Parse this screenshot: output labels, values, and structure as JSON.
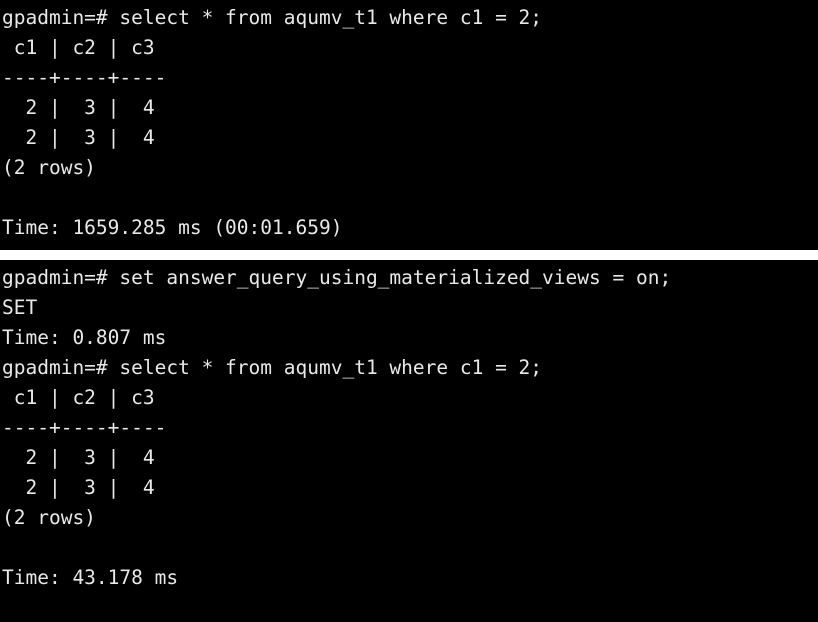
{
  "terminals": [
    {
      "name": "top-terminal",
      "background": "#000000",
      "foreground": "#e8e8e8",
      "lines": [
        "gpadmin=# select * from aqumv_t1 where c1 = 2;",
        " c1 | c2 | c3 ",
        "----+----+----",
        "  2 |  3 |  4",
        "  2 |  3 |  4",
        "(2 rows)",
        "",
        "Time: 1659.285 ms (00:01.659)"
      ]
    },
    {
      "name": "bottom-terminal",
      "background": "#000000",
      "foreground": "#e8e8e8",
      "lines": [
        "gpadmin=# set answer_query_using_materialized_views = on;",
        "SET",
        "Time: 0.807 ms",
        "gpadmin=# select * from aqumv_t1 where c1 = 2;",
        " c1 | c2 | c3 ",
        "----+----+----",
        "  2 |  3 |  4",
        "  2 |  3 |  4",
        "(2 rows)",
        "",
        "Time: 43.178 ms"
      ]
    }
  ]
}
